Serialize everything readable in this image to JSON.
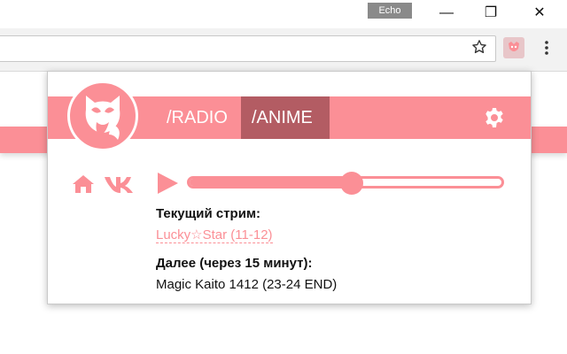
{
  "browser": {
    "profile_label": "Echo",
    "window_controls": {
      "minimize": "—",
      "restore": "❐",
      "close": "✕"
    },
    "icons": [
      "star-icon",
      "extension-icon",
      "menu-icon"
    ]
  },
  "popup": {
    "tabs": [
      {
        "label": "/RADIO",
        "active": false
      },
      {
        "label": "/ANIME",
        "active": true
      }
    ],
    "icons": [
      "fox-logo-icon",
      "gear-icon",
      "home-icon",
      "vk-icon",
      "play-icon"
    ],
    "player": {
      "progress": 0.52
    },
    "current_label": "Текущий стрим:",
    "current_title": "Lucky☆Star (11-12)",
    "next_label": "Далее (через 15 минут):",
    "next_title": "Magic Kaito 1412 (23-24 END)"
  },
  "colors": {
    "accent": "#fb8f96",
    "active_tab": "#b35c63"
  }
}
